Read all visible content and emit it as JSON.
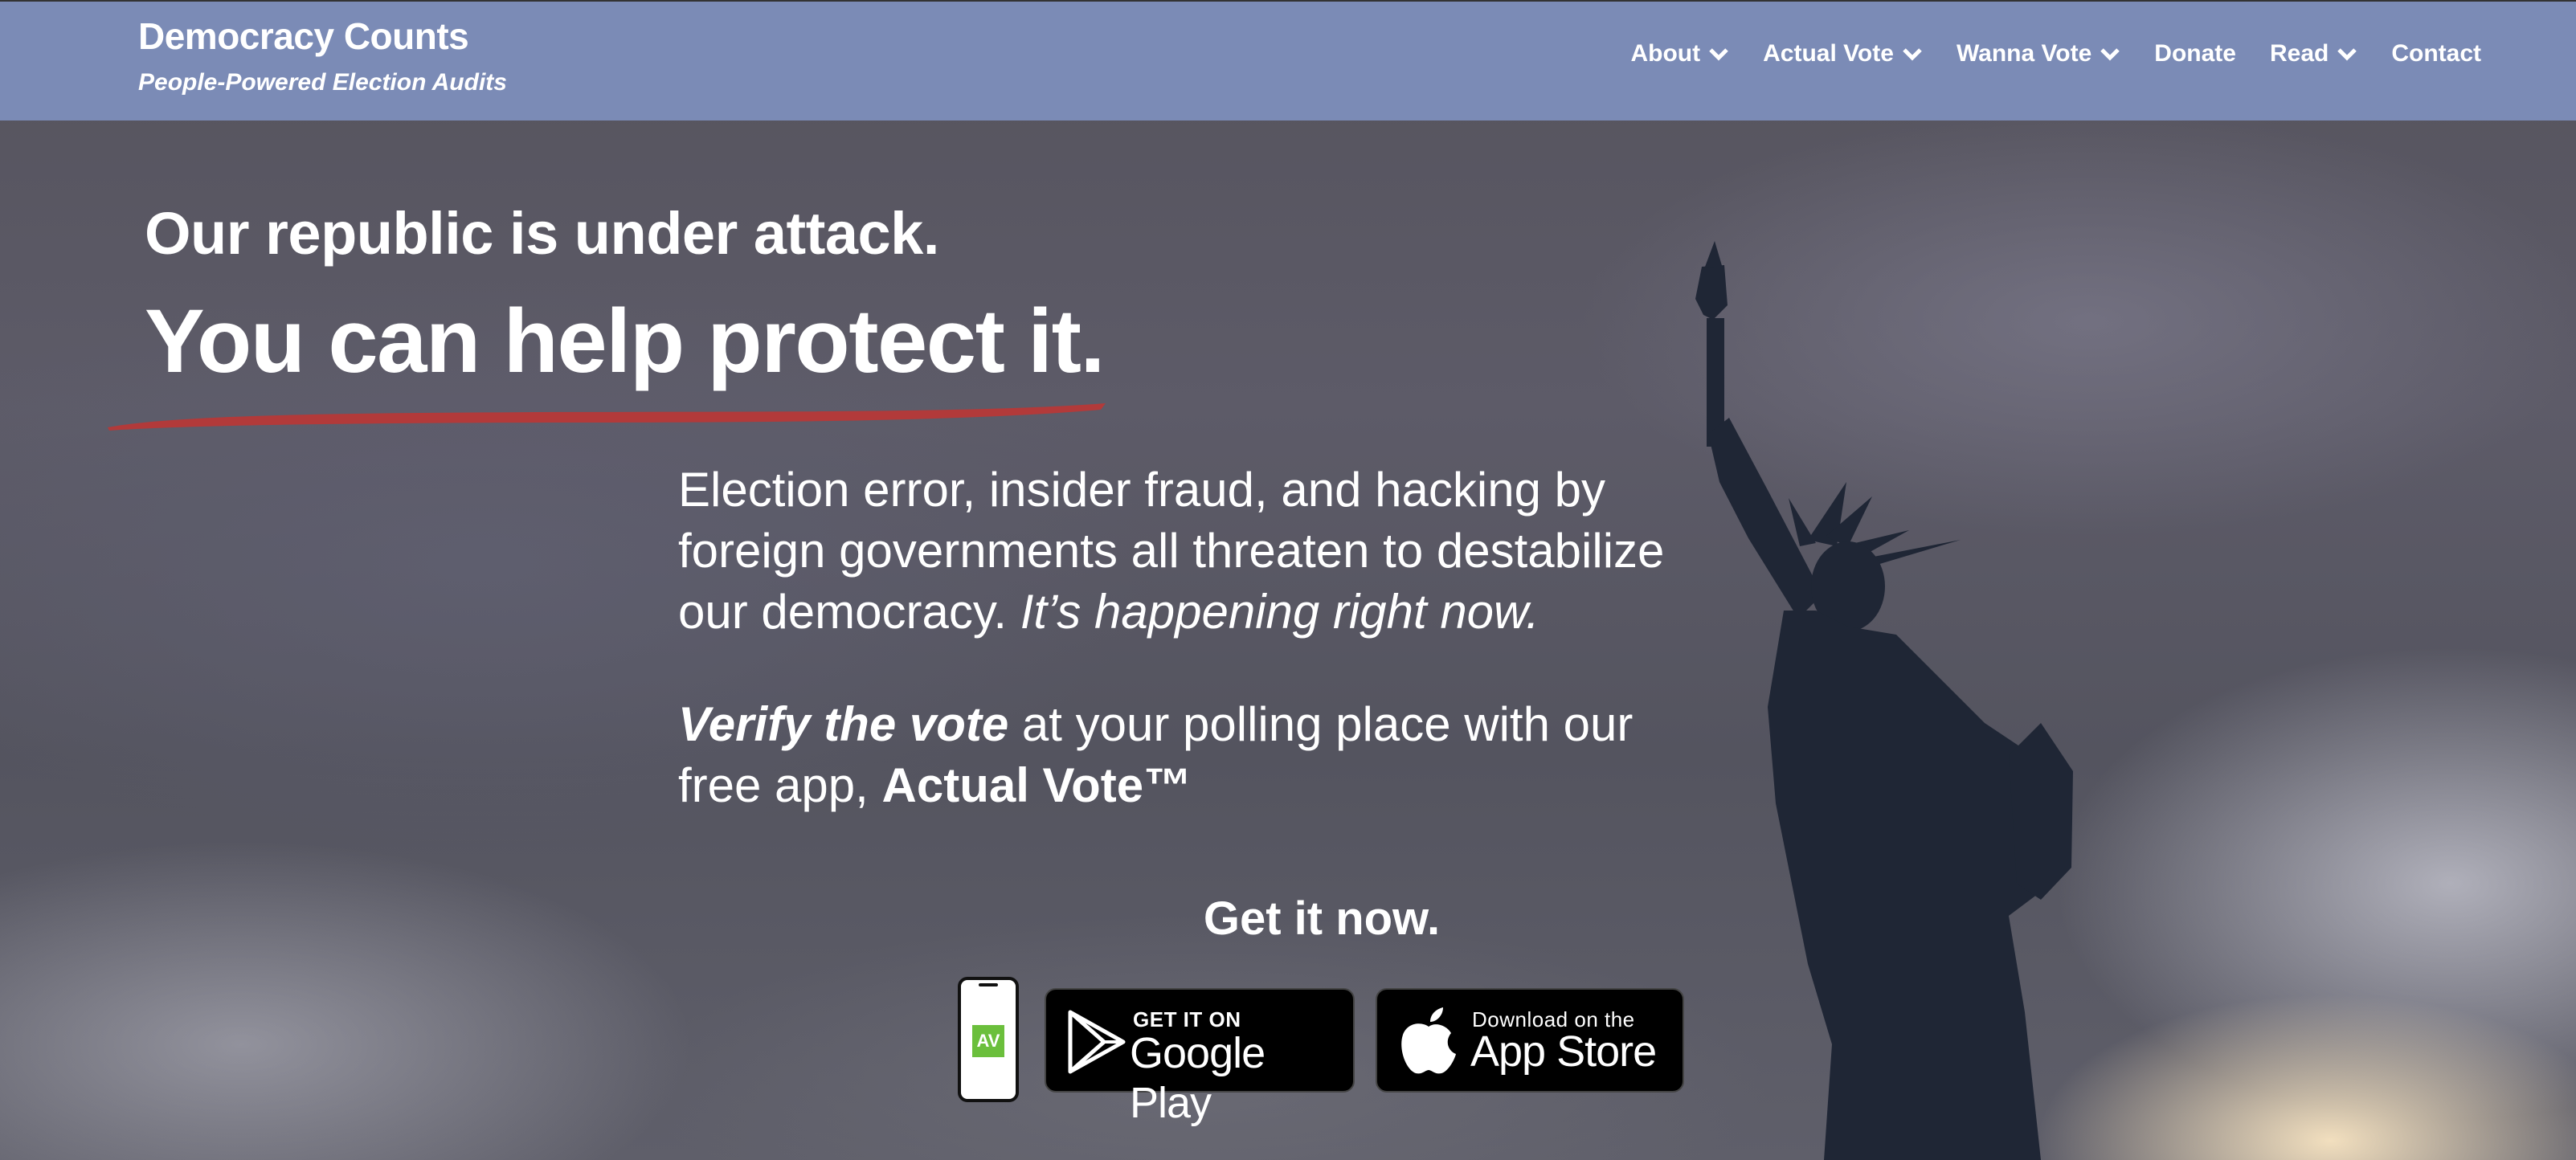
{
  "site": {
    "title": "Democracy Counts",
    "tagline": "People-Powered Election Audits"
  },
  "nav": {
    "items": [
      {
        "label": "About",
        "dropdown": true
      },
      {
        "label": "Actual Vote",
        "dropdown": true
      },
      {
        "label": "Wanna Vote",
        "dropdown": true
      },
      {
        "label": "Donate",
        "dropdown": false
      },
      {
        "label": "Read",
        "dropdown": true
      },
      {
        "label": "Contact",
        "dropdown": false
      }
    ]
  },
  "hero": {
    "headline_line1": "Our republic is under attack.",
    "headline_line2": "You can help protect it.",
    "para1_text": "Election error, insider fraud, and hacking by foreign governments all threaten to destabilize our democracy.",
    "para1_emphasis": "It’s happening right now.",
    "para2_emphasis": "Verify the vote",
    "para2_text": "at your polling place with our free app,",
    "para2_app": "Actual Vote™",
    "cta": "Get it now."
  },
  "downloads": {
    "app_icon_text": "AV",
    "google_play_small": "GET IT ON",
    "google_play_big": "Google Play",
    "app_store_small": "Download on the",
    "app_store_big": "App Store"
  },
  "colors": {
    "navbar": "#7b8bb6",
    "swoosh": "#b23a3a",
    "app_icon": "#6bbf3c"
  }
}
